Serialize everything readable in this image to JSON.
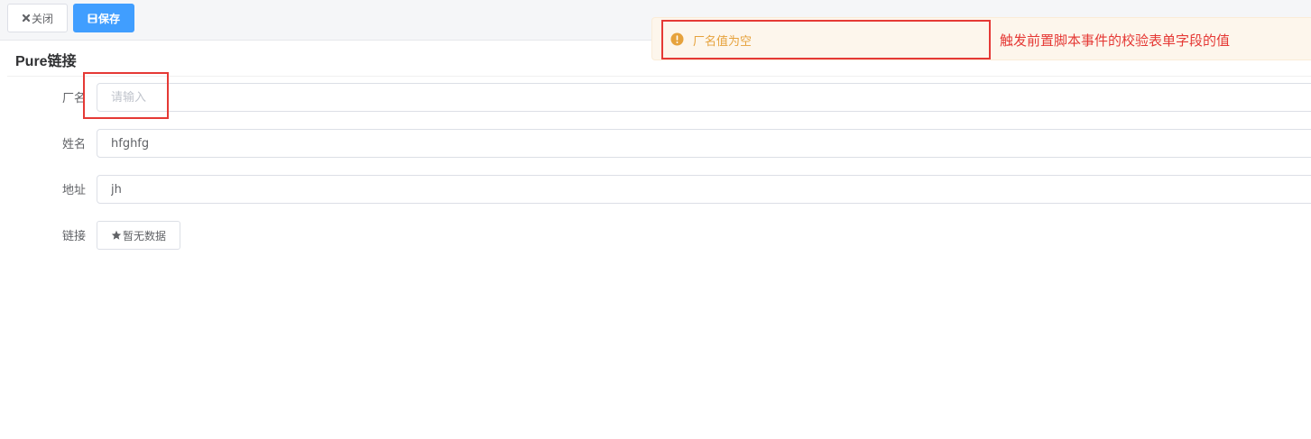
{
  "toolbar": {
    "close_label": "关闭",
    "save_label": "保存"
  },
  "section": {
    "title": "Pure链接"
  },
  "form": {
    "fields": [
      {
        "label": "厂名",
        "value": "",
        "placeholder": "请输入"
      },
      {
        "label": "姓名",
        "value": "hfghfg",
        "placeholder": ""
      },
      {
        "label": "地址",
        "value": "jh",
        "placeholder": ""
      }
    ],
    "link": {
      "label": "链接",
      "button_label": "暂无数据"
    }
  },
  "alert": {
    "message": "厂名值为空",
    "color": "#e6a23c",
    "icon": "warning-circle-icon"
  },
  "annotation": {
    "text": "触发前置脚本事件的校验表单字段的值",
    "color": "#e53935"
  },
  "colors": {
    "primary": "#409eff",
    "warning": "#e6a23c",
    "annotation": "#e53935"
  }
}
